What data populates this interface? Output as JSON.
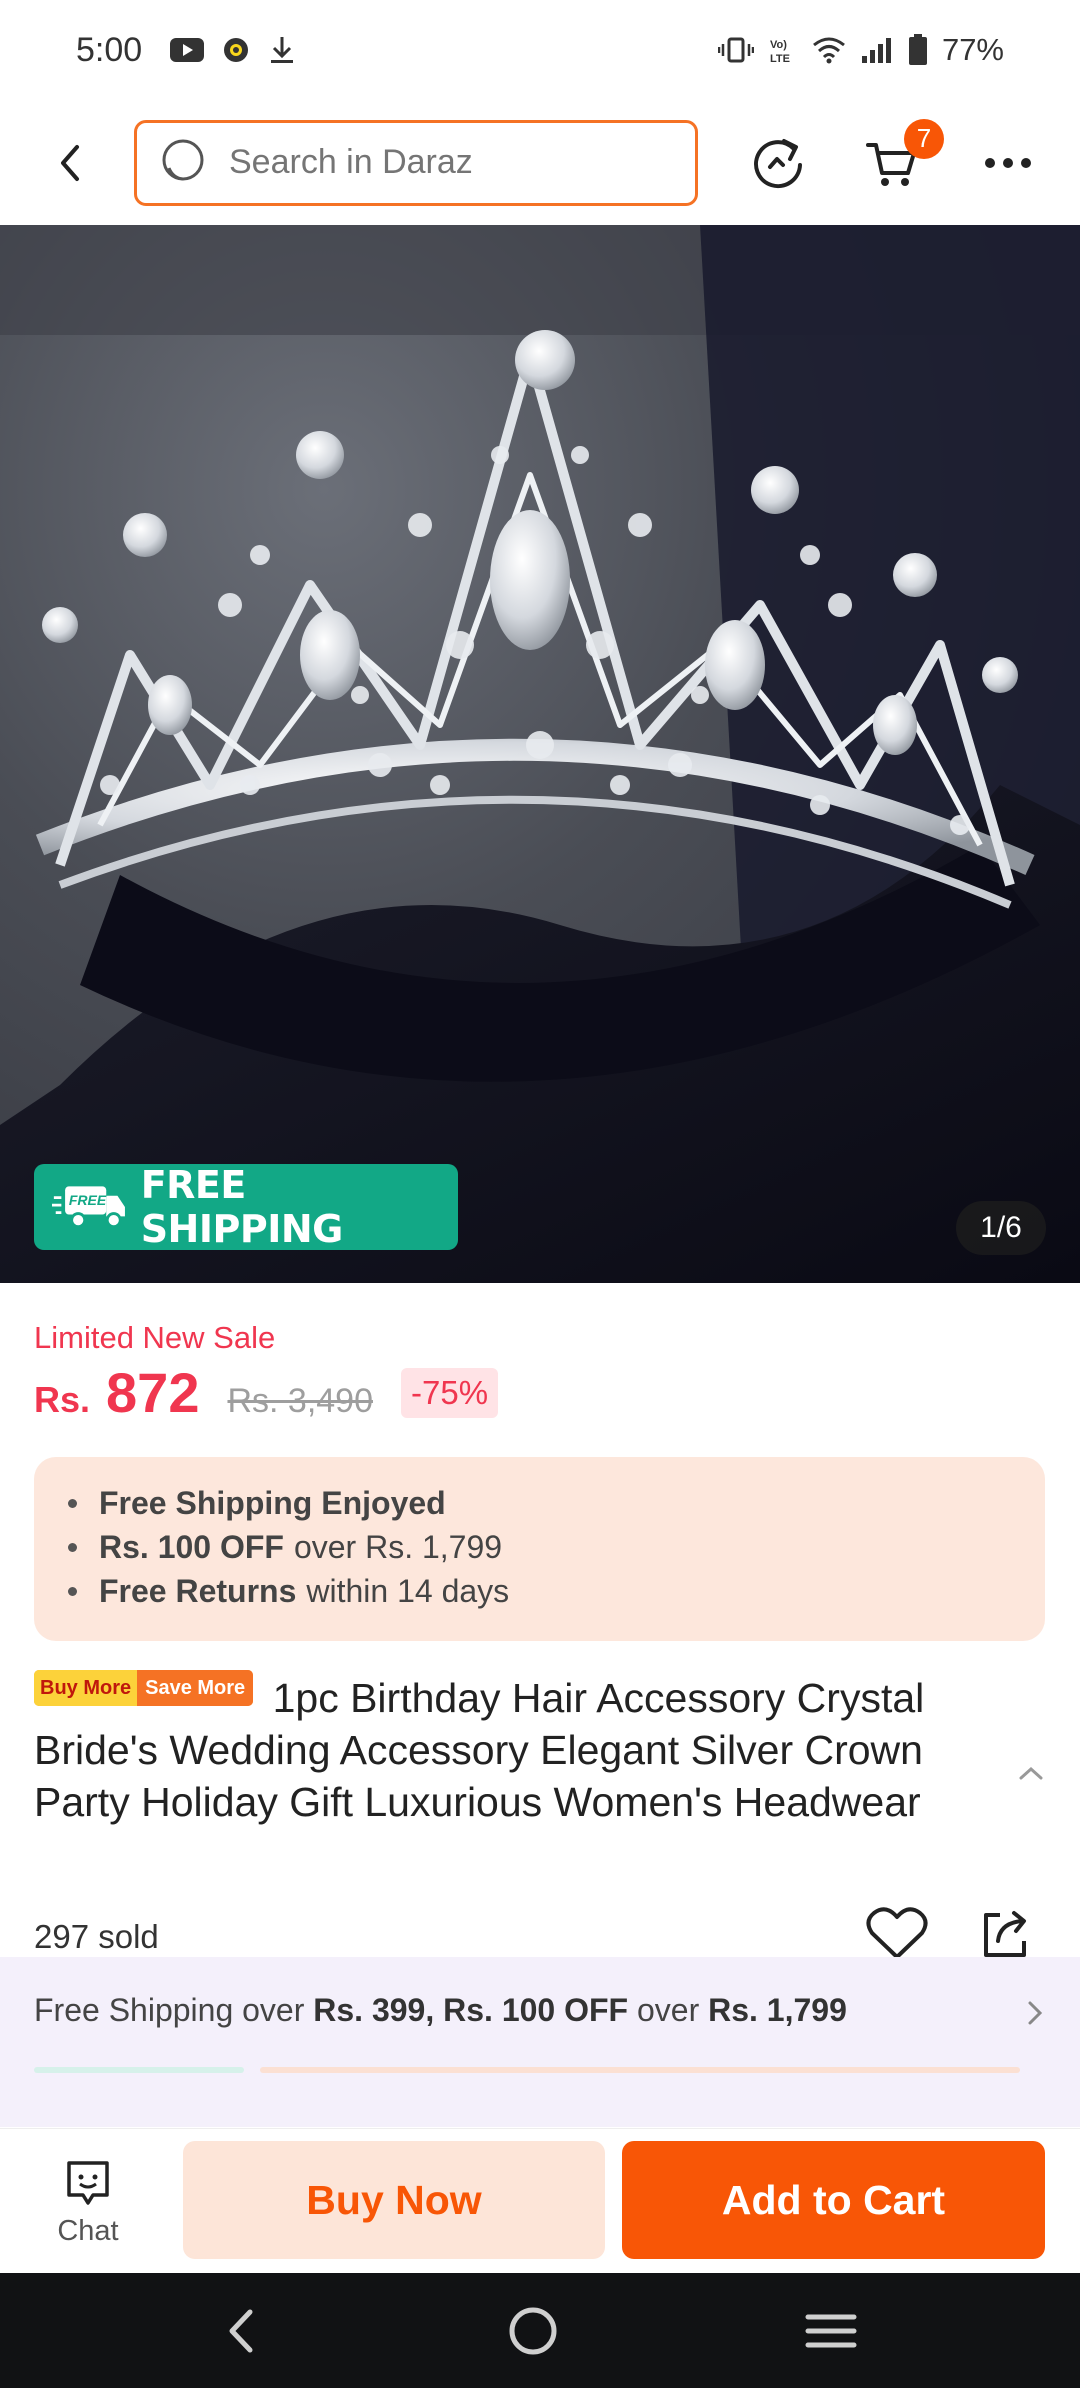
{
  "status_bar": {
    "time": "5:00",
    "left_icons": [
      "youtube-icon",
      "app-notification-icon",
      "download-icon"
    ],
    "right_icons": [
      "vibrate-icon",
      "volte-icon",
      "wifi-icon",
      "signal-icon",
      "battery-icon"
    ],
    "battery": "77%"
  },
  "topnav": {
    "search_placeholder": "Search in Daraz",
    "cart_count": "7"
  },
  "hero": {
    "free_shipping_label": "FREE SHIPPING",
    "free_tag": "FREE",
    "image_counter": "1/6"
  },
  "price": {
    "sale_label": "Limited New Sale",
    "currency": "Rs.",
    "current": "872",
    "original": "Rs. 3,490",
    "discount": "-75%"
  },
  "perks": [
    {
      "strong": "Free Shipping Enjoyed",
      "rest": ""
    },
    {
      "strong": "Rs. 100 OFF",
      "rest": "over Rs. 1,799"
    },
    {
      "strong": "Free Returns",
      "rest": "within 14 days"
    }
  ],
  "product": {
    "promo_tag_a": "Buy More",
    "promo_tag_b": "Save More",
    "title": "1pc Birthday Hair Accessory Crystal Bride's Wedding Accessory Elegant Silver Crown Party Holiday Gift Luxurious Women's Headwear",
    "sold": "297 sold"
  },
  "shipping_bar": {
    "prefix": "Free Shipping over",
    "strong1": "Rs. 399, Rs. 100 OFF",
    "middle": "over",
    "strong2": "Rs. 1,799"
  },
  "actions": {
    "chat_label": "Chat",
    "buy_now_label": "Buy Now",
    "add_to_cart_label": "Add to Cart"
  },
  "colors": {
    "accent": "#f85606",
    "price": "#f0364f",
    "free_shipping_badge": "#12a886"
  }
}
